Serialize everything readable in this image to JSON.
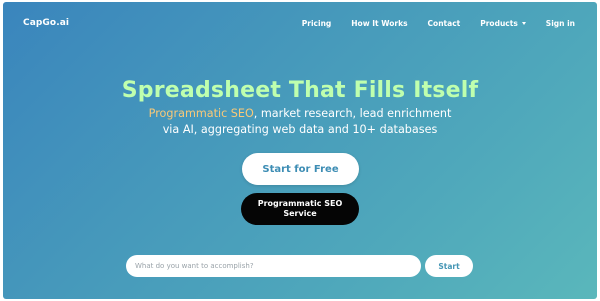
{
  "nav": {
    "logo": "CapGo.ai",
    "links": [
      {
        "label": "Pricing"
      },
      {
        "label": "How It Works"
      },
      {
        "label": "Contact"
      },
      {
        "label": "Products",
        "icon": "chevron-down-icon"
      },
      {
        "label": "Sign in"
      }
    ]
  },
  "hero": {
    "headline": "Spreadsheet That Fills Itself",
    "subline_highlight": "Programmatic SEO",
    "subline_rest_1": ", market research, lead enrichment",
    "subline_2": "via AI, aggregating web data and 10+ databases"
  },
  "cta": {
    "primary": "Start for Free",
    "secondary": "Programmatic SEO Service"
  },
  "search": {
    "placeholder": "What do you want to accomplish?",
    "value": "",
    "button": "Start"
  },
  "colors": {
    "gradient_start": "#3a85bd",
    "gradient_end": "#5ab7bb",
    "headline": "#bfffae",
    "highlight": "#f9c978",
    "secondary_button": "#050505"
  }
}
